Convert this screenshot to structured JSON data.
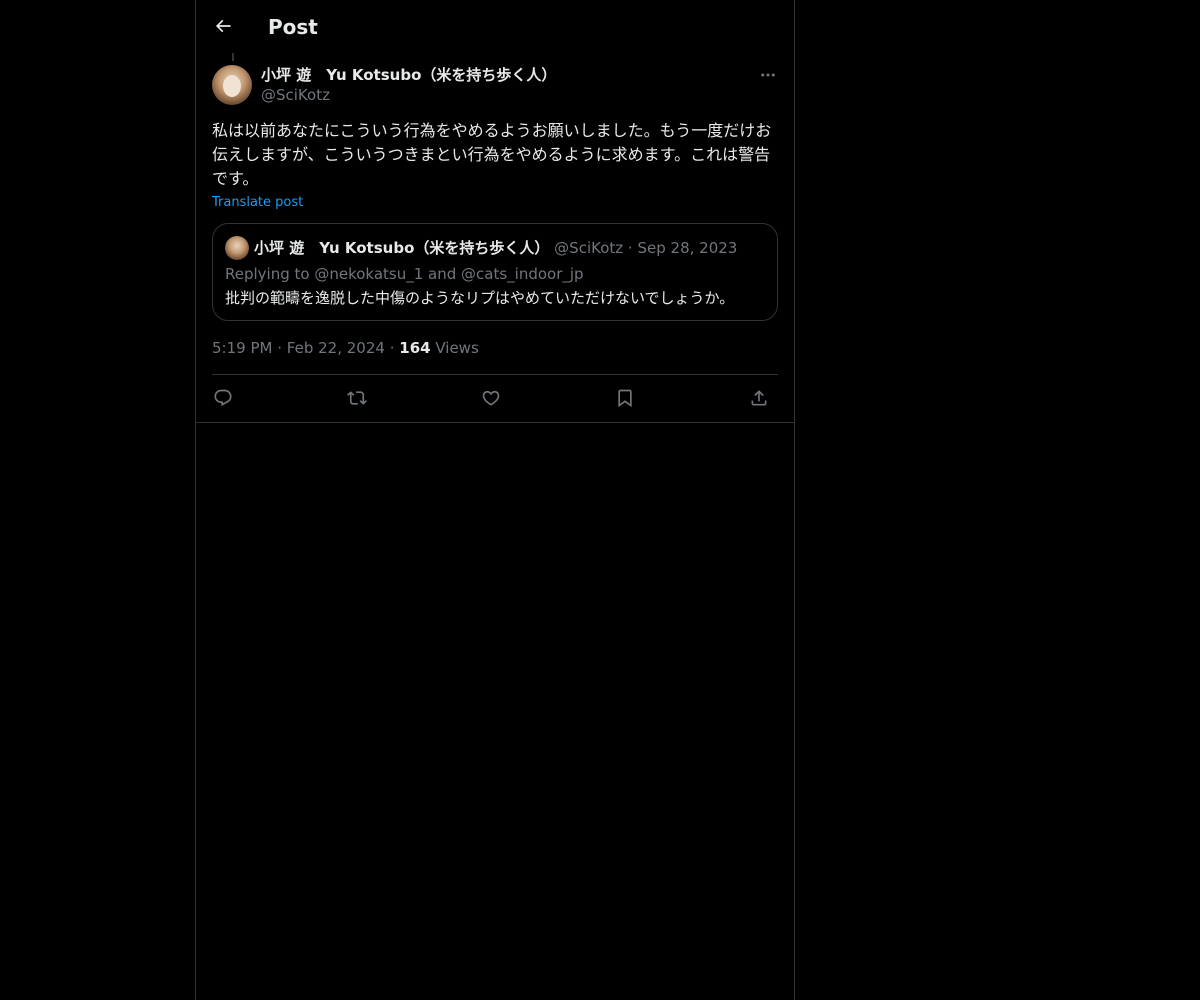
{
  "header": {
    "title": "Post"
  },
  "tweet": {
    "display_name": "小坪 遊　Yu Kotsubo（米を持ち歩く人）",
    "handle": "@SciKotz",
    "text": "私は以前あなたにこういう行為をやめるようお願いしました。もう一度だけお伝えしますが、こういうつきまとい行為をやめるように求めます。これは警告です。",
    "translate_label": "Translate post",
    "time": "5:19 PM",
    "separator": "·",
    "date": "Feb 22, 2024",
    "views_count": "164",
    "views_label": "Views"
  },
  "quote": {
    "display_name": "小坪 遊　Yu Kotsubo（米を持ち歩く人）",
    "handle": "@SciKotz",
    "separator": "·",
    "date": "Sep 28, 2023",
    "replying_to": "Replying to @nekokatsu_1 and @cats_indoor_jp",
    "text": "批判の範疇を逸脱した中傷のようなリプはやめていただけないでしょうか。"
  },
  "icons": {
    "back": "arrow-left-icon",
    "more": "more-dots-icon",
    "reply": "reply-icon",
    "repost": "repost-icon",
    "like": "heart-icon",
    "bookmark": "bookmark-icon",
    "share": "share-icon"
  },
  "colors": {
    "background": "#000000",
    "text_primary": "#e7e9ea",
    "text_secondary": "#71767b",
    "link": "#1d9bf0",
    "border": "#2f3336"
  }
}
